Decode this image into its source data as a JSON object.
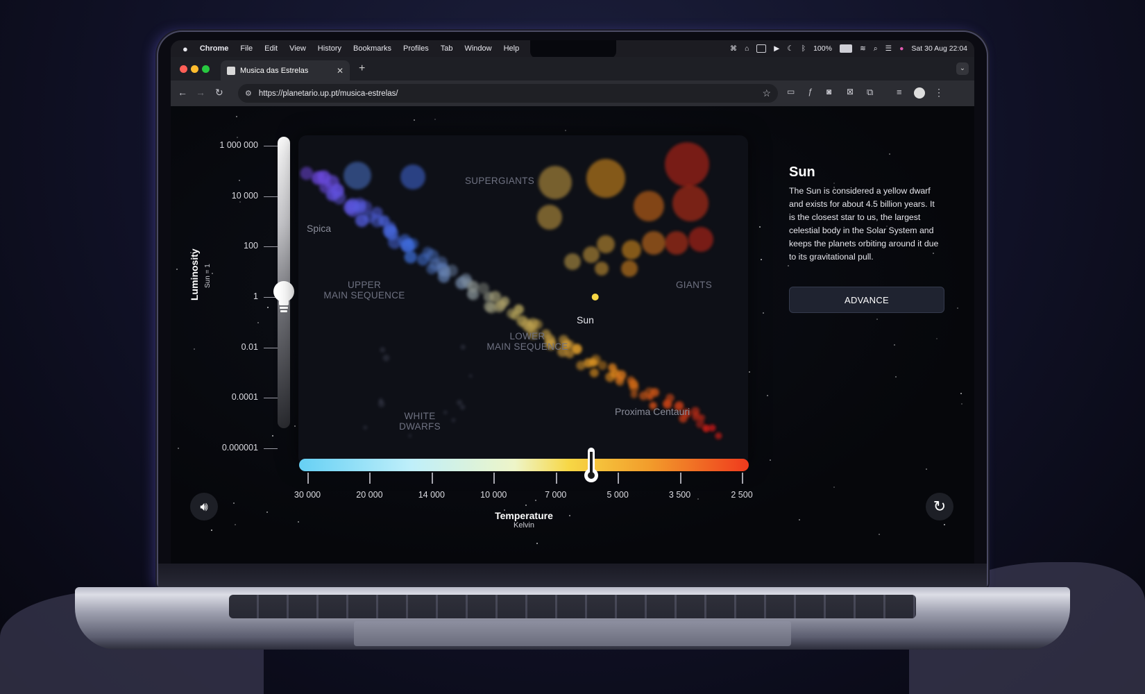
{
  "menubar": {
    "apple": "",
    "app": "Chrome",
    "items": [
      "File",
      "Edit",
      "View",
      "History",
      "Bookmarks",
      "Profiles",
      "Tab",
      "Window",
      "Help"
    ],
    "battery": "100%",
    "datetime": "Sat 30 Aug 22:04"
  },
  "browser": {
    "tab_title": "Musica das Estrelas",
    "url": "https://planetario.up.pt/musica-estrelas/",
    "new_tab": "+"
  },
  "chart_data": {
    "type": "scatter",
    "title": "",
    "ylabel": "Luminosity",
    "ylabel_sub": "Sun = 1",
    "xlabel": "Temperature",
    "xlabel_sub": "Kelvin",
    "y_ticks": [
      "1 000 000",
      "10 000",
      "100",
      "1",
      "0.01",
      "0.0001",
      "0.000001"
    ],
    "x_ticks": [
      "30 000",
      "20 000",
      "14 000",
      "10 000",
      "7 000",
      "5 000",
      "3 500",
      "2 500"
    ],
    "x_axis": "reversed",
    "regions": [
      {
        "label_lines": [
          "SUPERGIANTS"
        ]
      },
      {
        "label_lines": [
          "UPPER",
          "MAIN SEQUENCE"
        ]
      },
      {
        "label_lines": [
          "LOWER",
          "MAIN SEQUENCE"
        ]
      },
      {
        "label_lines": [
          "GIANTS"
        ]
      },
      {
        "label_lines": [
          "WHITE",
          "DWARFS"
        ]
      }
    ],
    "named_stars": [
      "Spica",
      "Sun",
      "Proxima Centauri"
    ],
    "selected": {
      "name": "Sun",
      "temperature_k": 5778,
      "luminosity": 1
    },
    "temperature_slider_value": 5778,
    "luminosity_slider_value": 1
  },
  "panel": {
    "title": "Sun",
    "description": "The Sun is considered a yellow dwarf and exists for about 4.5 billion years. It is the closest star to us, the largest celestial body in the Solar System and keeps the planets orbiting around it due to its gravitational pull.",
    "advance_label": "ADVANCE"
  },
  "colors": {
    "accent": "#f7d745",
    "bg": "#06070b"
  }
}
